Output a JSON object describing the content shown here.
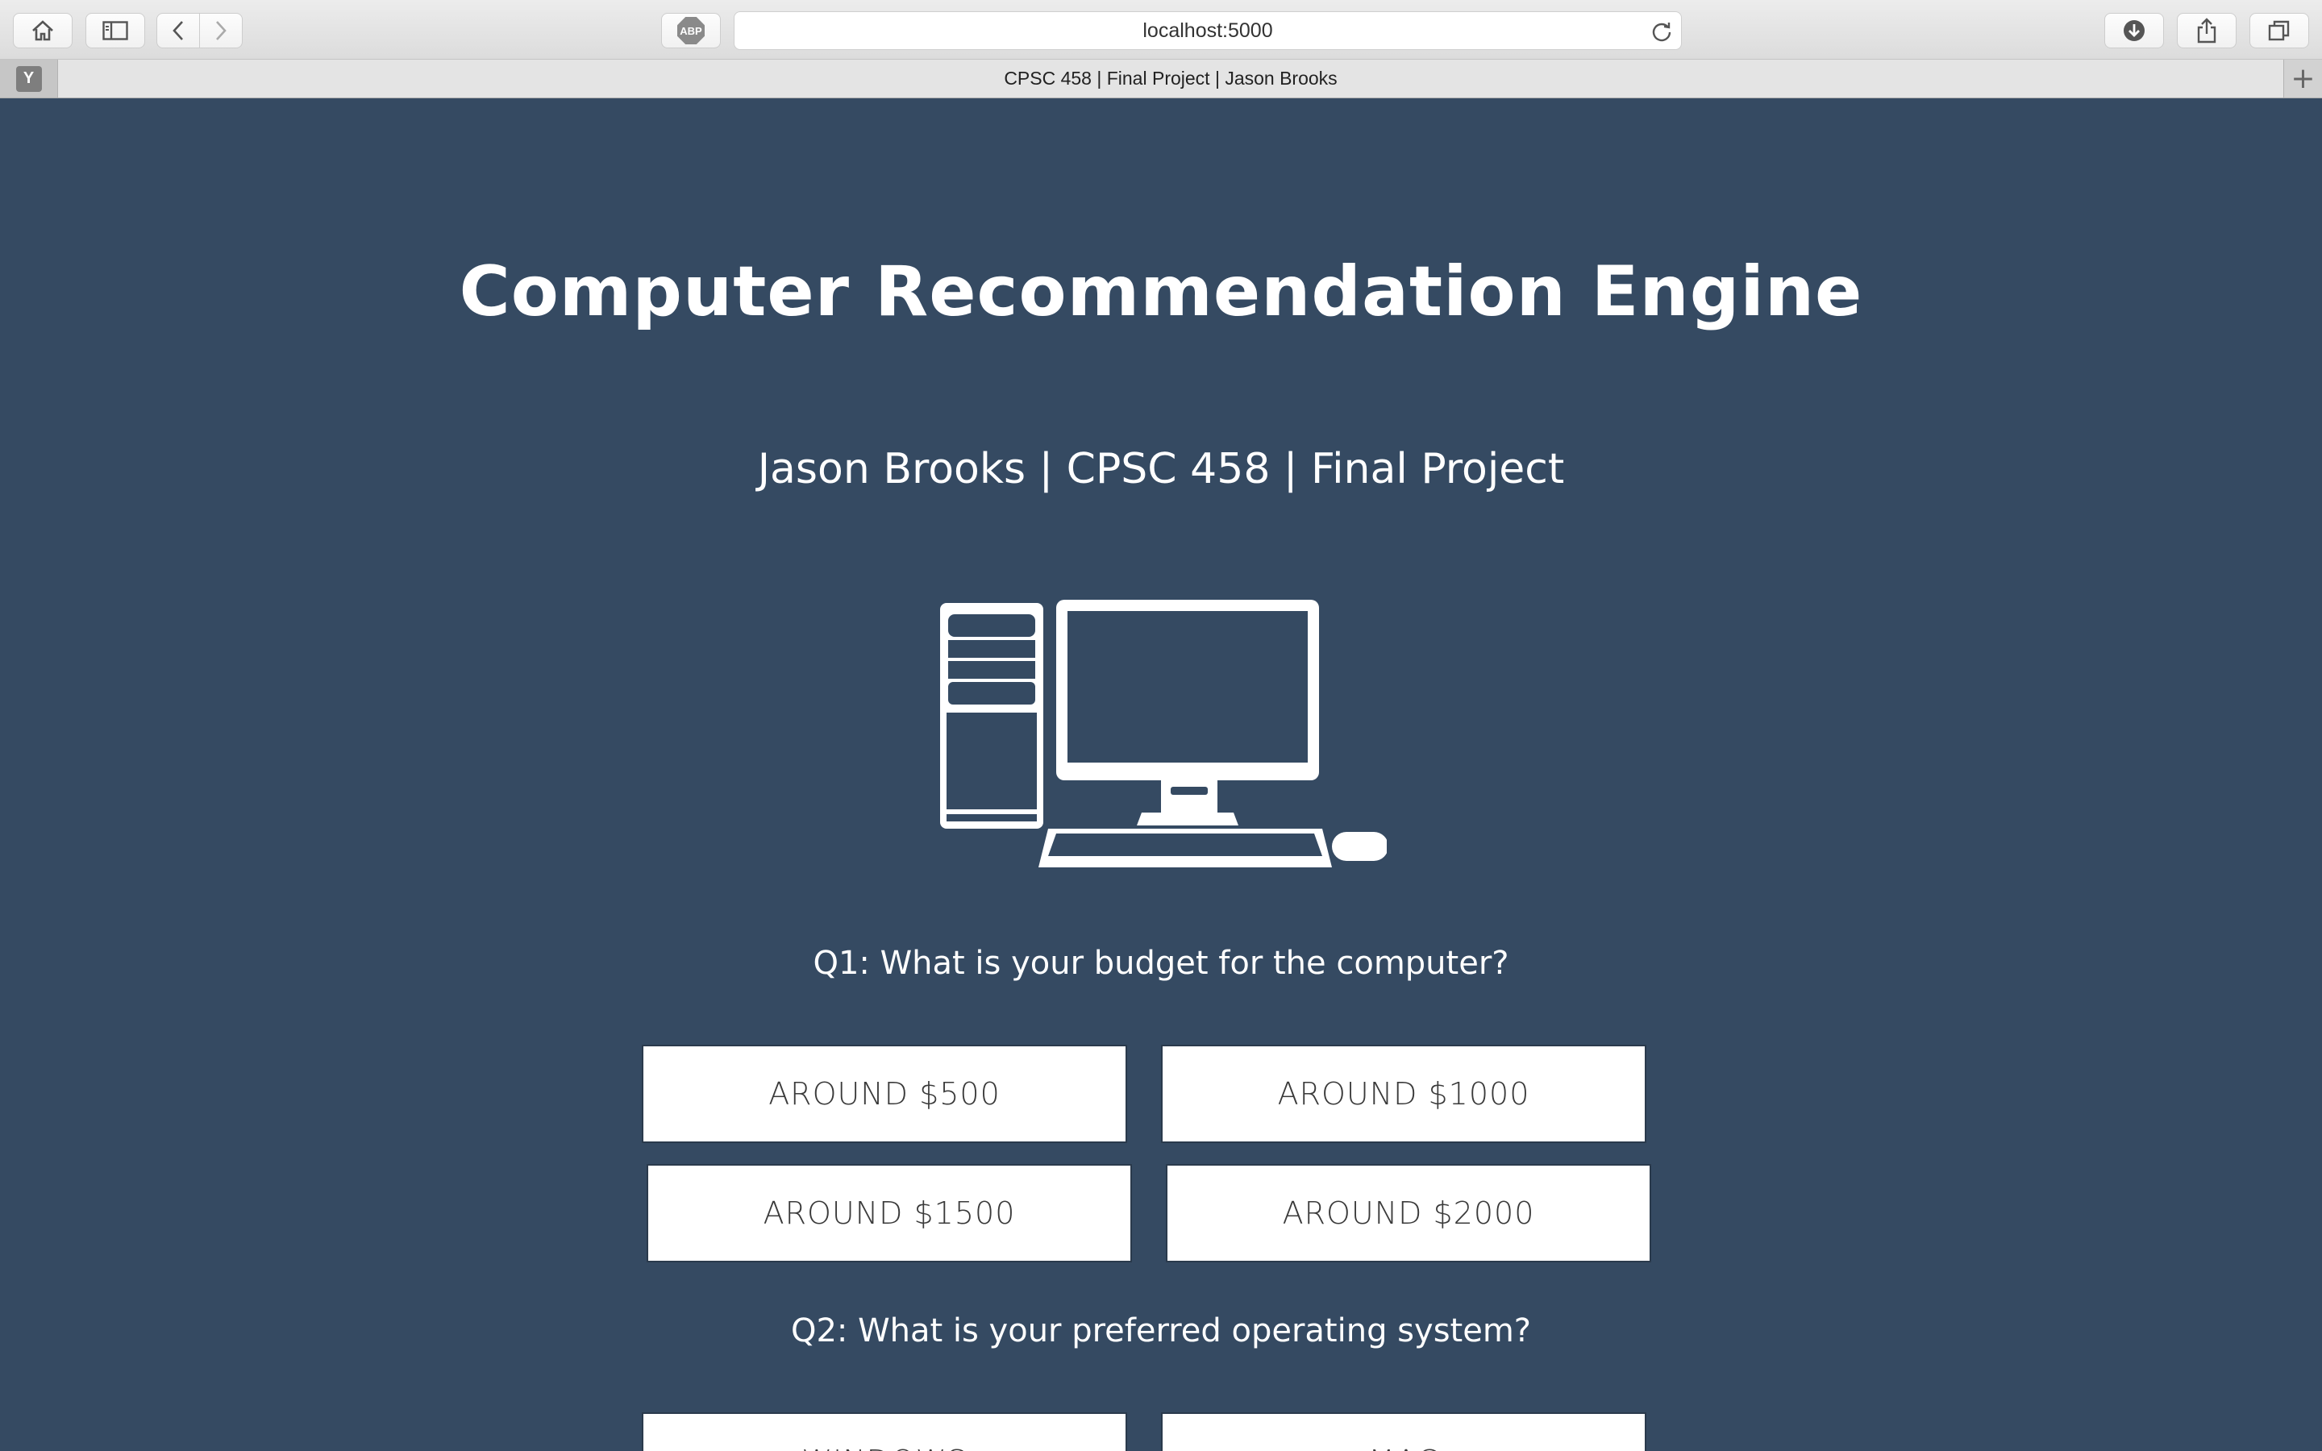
{
  "browser": {
    "url": "localhost:5000",
    "tab_title": "CPSC 458 | Final Project | Jason Brooks",
    "favicon_letter": "Y",
    "new_tab_symbol": "+",
    "adblock_label": "ABP"
  },
  "page": {
    "background_color": "#354a62",
    "title": "Computer Recommendation Engine",
    "subtitle": "Jason Brooks | CPSC 458 | Final Project",
    "hero_icon": "desktop-computer-icon"
  },
  "questions": [
    {
      "label": "Q1: What is your budget for the computer?",
      "options": [
        "AROUND $500",
        "AROUND $1000",
        "AROUND $1500",
        "AROUND $2000"
      ]
    },
    {
      "label": "Q2: What is your preferred operating system?",
      "options": [
        "WINDOWS",
        "MAC"
      ]
    }
  ]
}
